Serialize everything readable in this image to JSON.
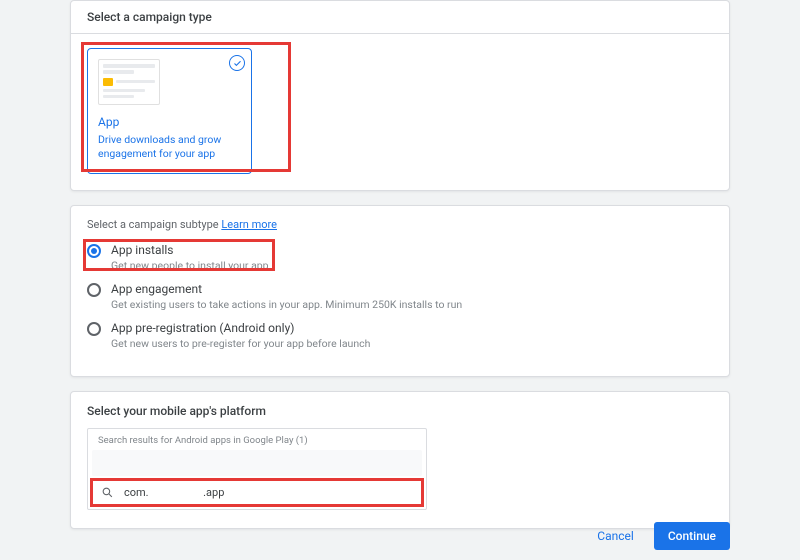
{
  "section1": {
    "header": "Select a campaign type",
    "tile": {
      "title": "App",
      "desc": "Drive downloads and grow engagement for your app"
    }
  },
  "section2": {
    "label": "Select a campaign subtype",
    "learn_more": "Learn more",
    "options": [
      {
        "title": "App installs",
        "desc": "Get new people to install your app",
        "selected": true
      },
      {
        "title": "App engagement",
        "desc": "Get existing users to take actions in your app. Minimum 250K installs to run",
        "selected": false
      },
      {
        "title": "App pre-registration (Android only)",
        "desc": "Get new users to pre-register for your app before launch",
        "selected": false
      }
    ]
  },
  "section3": {
    "label": "Select your mobile app's platform",
    "results_header": "Search results for Android apps in Google Play (1)",
    "search_value": "com.                    .app"
  },
  "footer": {
    "cancel": "Cancel",
    "continue": "Continue"
  }
}
